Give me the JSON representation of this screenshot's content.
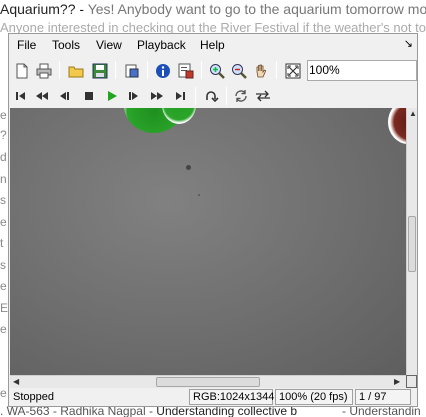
{
  "background_page": {
    "line0_a": "Aquarium?? - ",
    "line0_b": "Yes! Anybody want to go to the aquarium tomorrow morning",
    "line1": "Anyone interested in checking out the River Festival if the weather's not to",
    "bottom_a": ". WA-563 - Radhika Nagpal - ",
    "bottom_b": "Understanding collective b",
    "bottom_right": "- Understandin",
    "left_edge_fragments": [
      "e",
      "?",
      "d",
      "n",
      "s",
      "e",
      "t",
      "s",
      "e",
      "E",
      "e",
      "e"
    ]
  },
  "menu": {
    "items": [
      "File",
      "Tools",
      "View",
      "Playback",
      "Help"
    ],
    "overflow_arrow": "↘"
  },
  "toolbar": {
    "zoom_value": "100%",
    "buttons": [
      "new-icon",
      "print-icon",
      "open-folder-icon",
      "save-icon",
      "properties-icon",
      "info-icon",
      "image-info-icon",
      "zoom-in-icon",
      "zoom-out-icon",
      "pan-hand-icon",
      "fit-window-icon"
    ]
  },
  "playback": {
    "buttons": [
      "first-frame-icon",
      "rewind-icon",
      "step-back-icon",
      "stop-icon",
      "play-icon",
      "step-forward-icon",
      "fast-forward-icon",
      "last-frame-icon",
      "loop-icon",
      "repeat-icon",
      "bounce-icon"
    ],
    "play_color": "#1fa51f"
  },
  "status": {
    "state": "Stopped",
    "image_format": "RGB:1024x1344",
    "zoom_fps": "100% (20 fps)",
    "frame": "1 / 97"
  }
}
